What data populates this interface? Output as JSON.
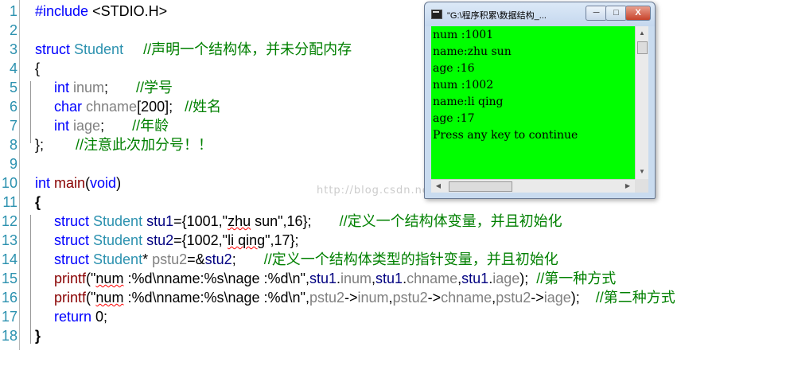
{
  "line_numbers": [
    "1",
    "2",
    "3",
    "4",
    "5",
    "6",
    "7",
    "8",
    "9",
    "10",
    "11",
    "12",
    "13",
    "14",
    "15",
    "16",
    "17",
    "18"
  ],
  "code": {
    "l1_include": "#include",
    "l1_header": " <STDIO.H>",
    "l3_struct": "struct",
    "l3_name": " Student",
    "l3_comment": "     //声明一个结构体，并未分配内存",
    "l4_brace": "{",
    "l5_type": "int",
    "l5_member": " inum",
    "l5_rest": ";",
    "l5_comment": "       //学号",
    "l6_type": "char",
    "l6_member": " chname",
    "l6_rest": "[200];",
    "l6_comment": "   //姓名",
    "l7_type": "int",
    "l7_member": " iage",
    "l7_rest": ";",
    "l7_comment": "       //年龄",
    "l8_close": "};",
    "l8_comment": "        //注意此次加分号！！",
    "l10_type": "int",
    "l10_func": " main",
    "l10_paren": "(",
    "l10_void": "void",
    "l10_close": ")",
    "l11_brace": "{",
    "l12_struct": "struct",
    "l12_sname": " Student",
    "l12_var": " stu1",
    "l12_init_a": "={1001,\"",
    "l12_str": "zhu",
    "l12_init_b": " sun\",16};",
    "l12_comment": "       //定义一个结构体变量，并且初始化",
    "l13_struct": "struct",
    "l13_sname": " Student",
    "l13_var": " stu2",
    "l13_init_a": "={1002,\"",
    "l13_str": "li qing",
    "l13_init_b": "\",17};",
    "l14_struct": "struct",
    "l14_sname": " Student",
    "l14_star": "*",
    "l14_var": " pstu2",
    "l14_eq": "=&",
    "l14_ref": "stu2",
    "l14_semi": ";",
    "l14_comment": "       //定义一个结构体类型的指针变量，并且初始化",
    "l15_fn": "printf",
    "l15_a": "(\"",
    "l15_num": "num",
    "l15_fmt": " :%d\\nname:%s\\nage :%d\\n\",",
    "l15_args": "stu1",
    "l15_dot1": ".",
    "l15_m1": "inum",
    "l15_c1": ",",
    "l15_args2": "stu1",
    "l15_dot2": ".",
    "l15_m2": "chname",
    "l15_c2": ",",
    "l15_args3": "stu1",
    "l15_dot3": ".",
    "l15_m3": "iage",
    "l15_end": ");",
    "l15_comment": "  //第一种方式",
    "l16_fn": "printf",
    "l16_a": "(\"",
    "l16_num": "num",
    "l16_fmt": " :%d\\nname:%s\\nage :%d\\n\",",
    "l16_p1": "pstu2",
    "l16_arrow1": "->",
    "l16_m1": "inum",
    "l16_c1": ",",
    "l16_p2": "pstu2",
    "l16_arrow2": "->",
    "l16_m2": "chname",
    "l16_c2": ",",
    "l16_p3": "pstu2",
    "l16_arrow3": "->",
    "l16_m3": "iage",
    "l16_end": ");",
    "l16_comment": "    //第二种方式",
    "l17_return": "return",
    "l17_val": " 0;",
    "l18_brace": "}"
  },
  "console": {
    "title": "\"G:\\程序积累\\数据结构_...",
    "min_label": "─",
    "max_label": "□",
    "close_label": "X",
    "lines": [
      "num :1001",
      "name:zhu sun",
      "age :16",
      "num :1002",
      "name:li qing",
      "age :17",
      "Press any key to continue"
    ],
    "background": "#00ff00"
  },
  "watermark": "http://blog.csdn.net/"
}
